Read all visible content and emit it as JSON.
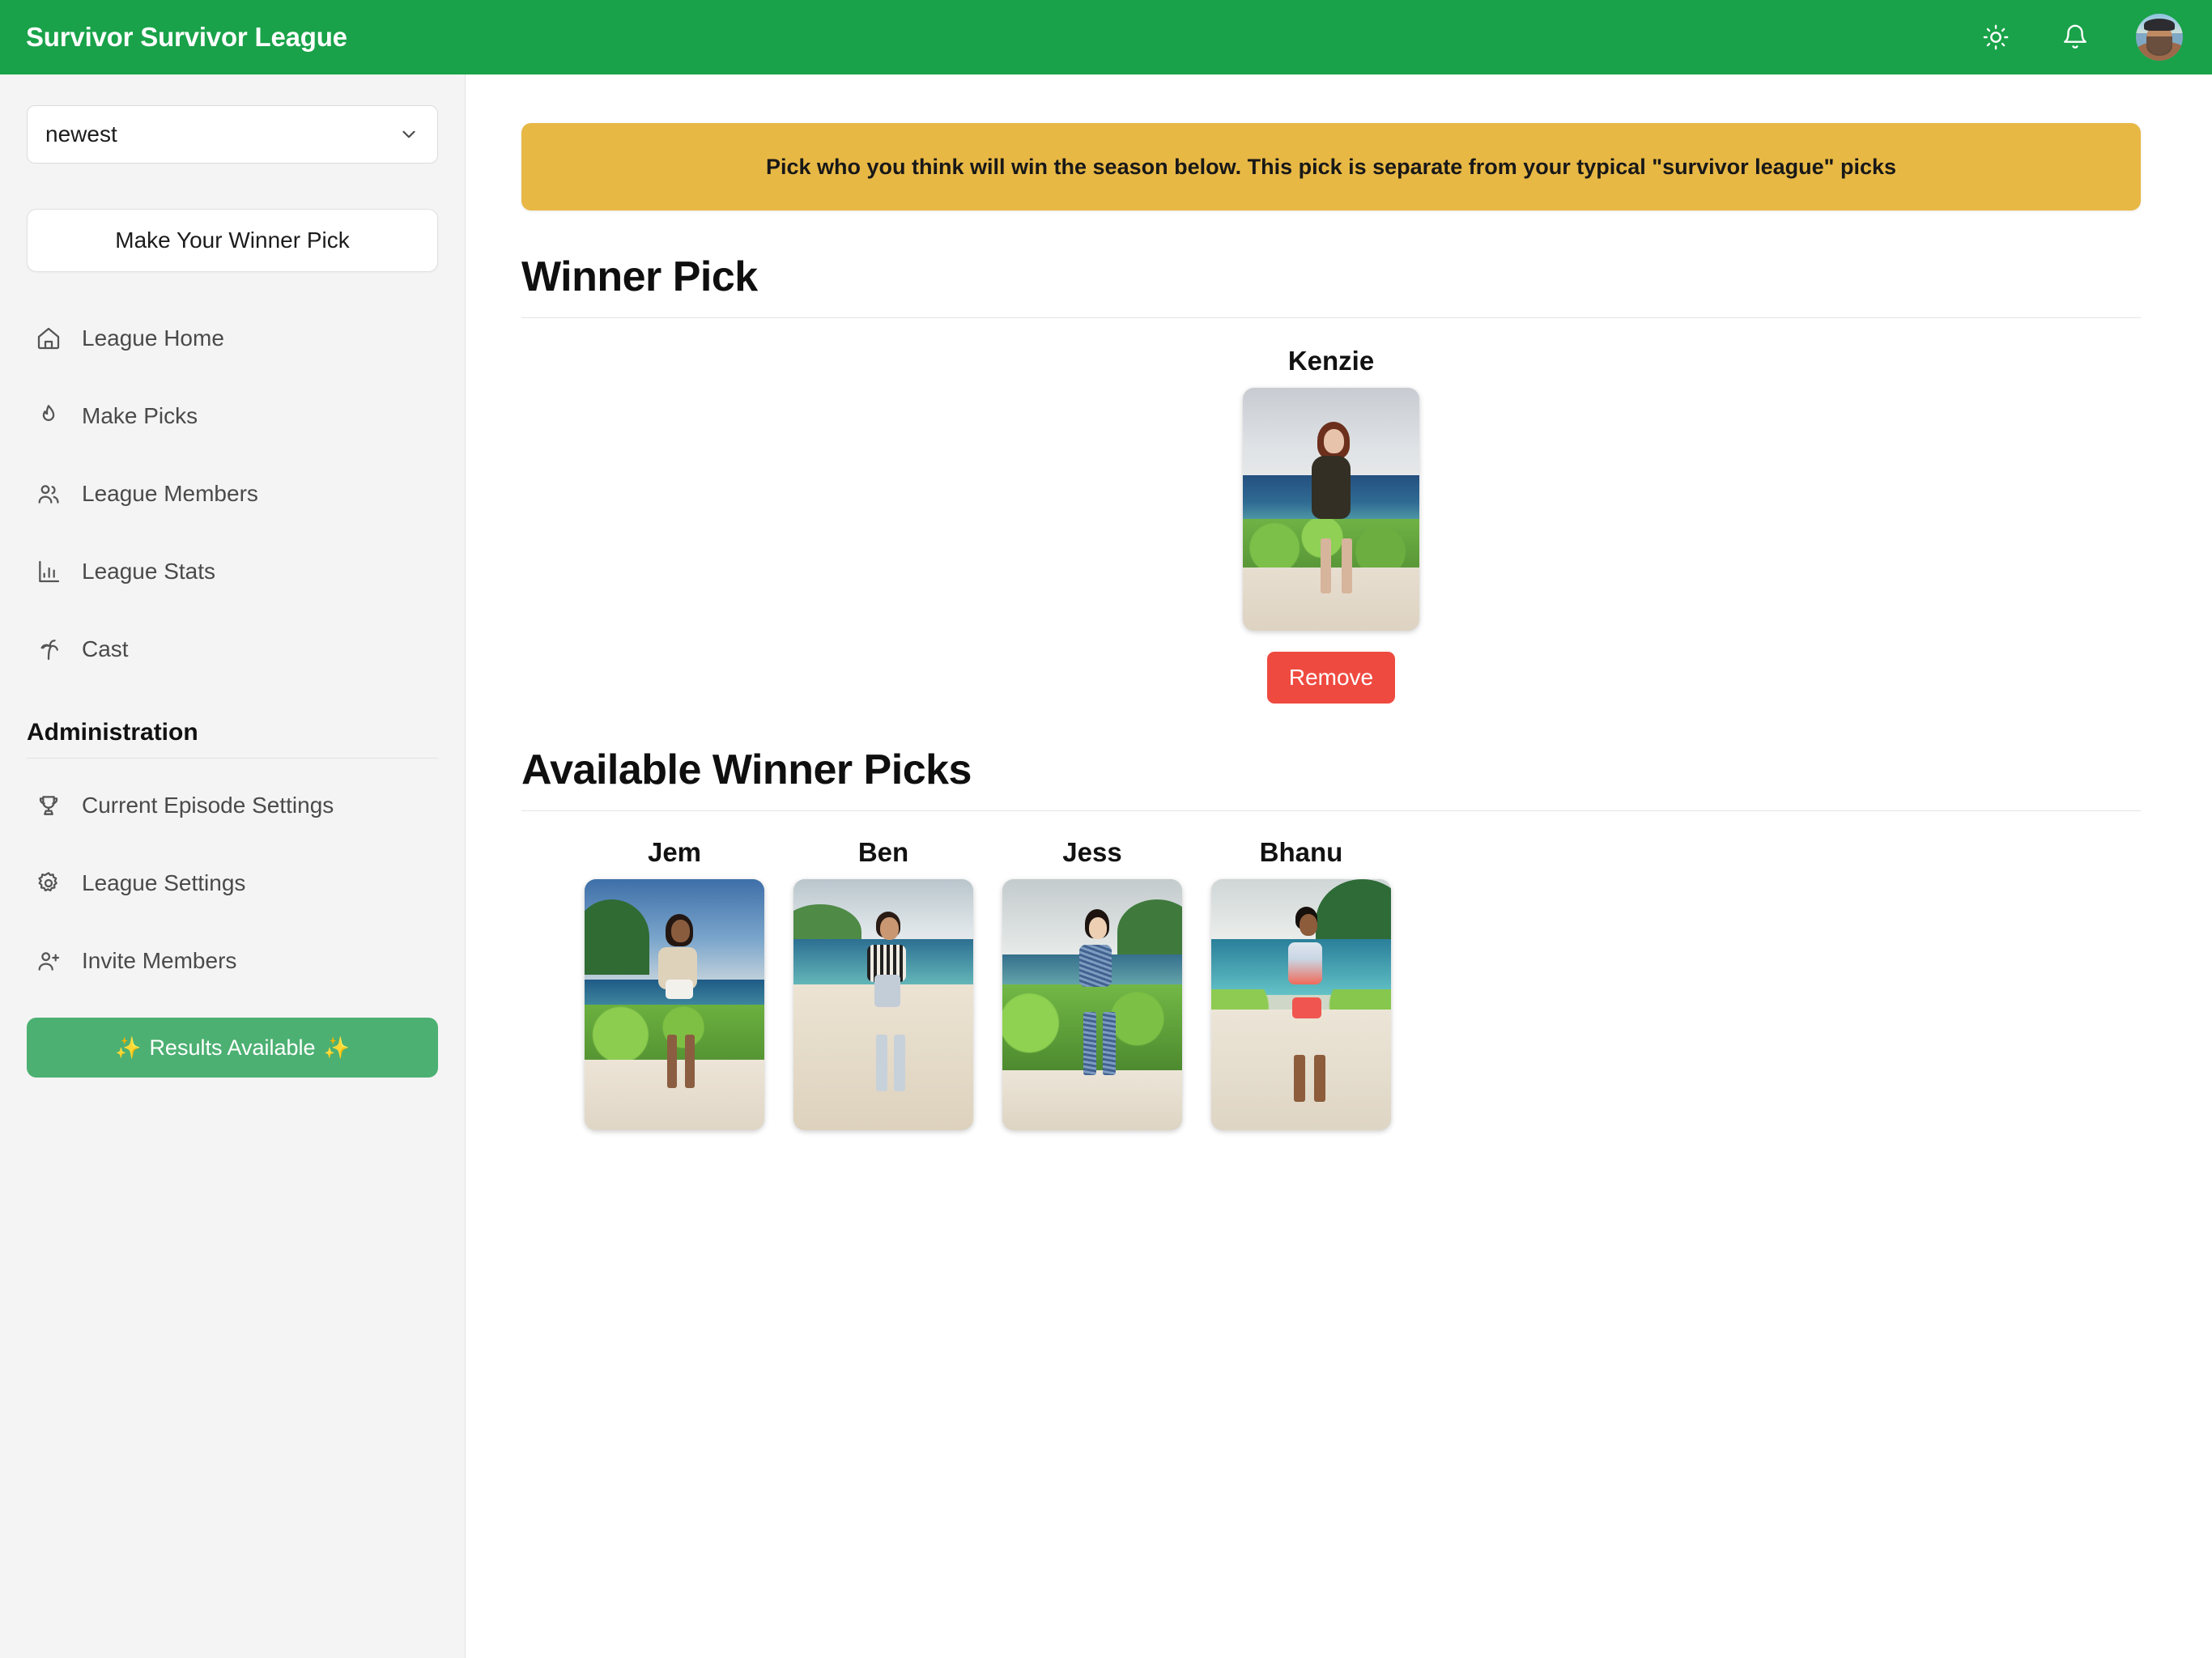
{
  "header": {
    "brand": "Survivor Survivor League",
    "icons": [
      {
        "name": "theme-toggle-icon",
        "label": "sun-icon"
      },
      {
        "name": "notifications-icon",
        "label": "bell-icon"
      },
      {
        "name": "user-avatar",
        "label": "avatar"
      }
    ]
  },
  "sidebar": {
    "league_select": {
      "value": "newest",
      "placeholder": "newest"
    },
    "winner_pick_button": "Make Your Winner Pick",
    "nav": [
      {
        "label": "League Home",
        "icon": "home-icon"
      },
      {
        "label": "Make Picks",
        "icon": "flame-icon"
      },
      {
        "label": "League Members",
        "icon": "users-icon"
      },
      {
        "label": "League Stats",
        "icon": "bar-chart-icon"
      },
      {
        "label": "Cast",
        "icon": "palm-tree-icon"
      }
    ],
    "admin_heading": "Administration",
    "admin_nav": [
      {
        "label": "Current Episode Settings",
        "icon": "trophy-icon"
      },
      {
        "label": "League Settings",
        "icon": "gear-icon"
      },
      {
        "label": "Invite Members",
        "icon": "user-plus-icon"
      }
    ],
    "results_button": {
      "label": "Results Available",
      "sparkle": "✨"
    }
  },
  "main": {
    "banner": "Pick who you think will win the season below. This pick is separate from your typical \"survivor league\" picks",
    "winner_section_title": "Winner Pick",
    "winner_pick": {
      "name": "Kenzie",
      "remove_label": "Remove"
    },
    "available_section_title": "Available Winner Picks",
    "available_picks": [
      {
        "name": "Jem"
      },
      {
        "name": "Ben"
      },
      {
        "name": "Jess"
      },
      {
        "name": "Bhanu"
      }
    ]
  },
  "colors": {
    "header_green": "#19a249",
    "banner_yellow": "#e8b845",
    "remove_red": "#ef4a40",
    "results_green": "#4cb072",
    "sidebar_bg": "#f4f4f4"
  }
}
